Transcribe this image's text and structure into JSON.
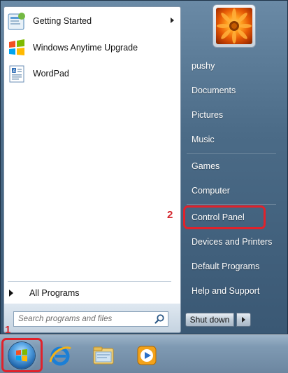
{
  "programs": [
    {
      "label": "Getting Started",
      "has_submenu": true
    },
    {
      "label": "Windows Anytime Upgrade",
      "has_submenu": false
    },
    {
      "label": "WordPad",
      "has_submenu": false
    }
  ],
  "all_programs_label": "All Programs",
  "search": {
    "placeholder": "Search programs and files"
  },
  "right_pane": {
    "items": [
      "pushy",
      "Documents",
      "Pictures",
      "Music",
      "Games",
      "Computer",
      "Control Panel",
      "Devices and Printers",
      "Default Programs",
      "Help and Support"
    ]
  },
  "shutdown_label": "Shut down",
  "annotations": {
    "start": "1",
    "control_panel": "2"
  },
  "colors": {
    "annotation_red": "#e0222b"
  },
  "taskbar_icons": [
    "internet-explorer-icon",
    "file-explorer-icon",
    "media-player-icon"
  ]
}
